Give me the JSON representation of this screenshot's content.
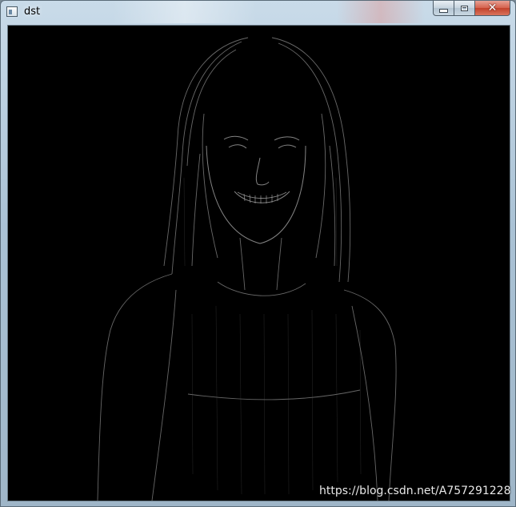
{
  "window": {
    "title": "dst",
    "icon": "app-window-icon",
    "controls": {
      "minimize_icon": "minimize-icon",
      "maximize_icon": "maximize-icon",
      "close_icon": "close-icon",
      "close_glyph": "✕"
    }
  },
  "image": {
    "description_icon": "edge-detection-output-image",
    "background_color": "#000000",
    "edge_color": "#9a9a9a"
  },
  "watermark": {
    "text": "https://blog.csdn.net/A757291228"
  },
  "colors": {
    "close_button": "#c2412a",
    "frame": "#aac2d5"
  }
}
